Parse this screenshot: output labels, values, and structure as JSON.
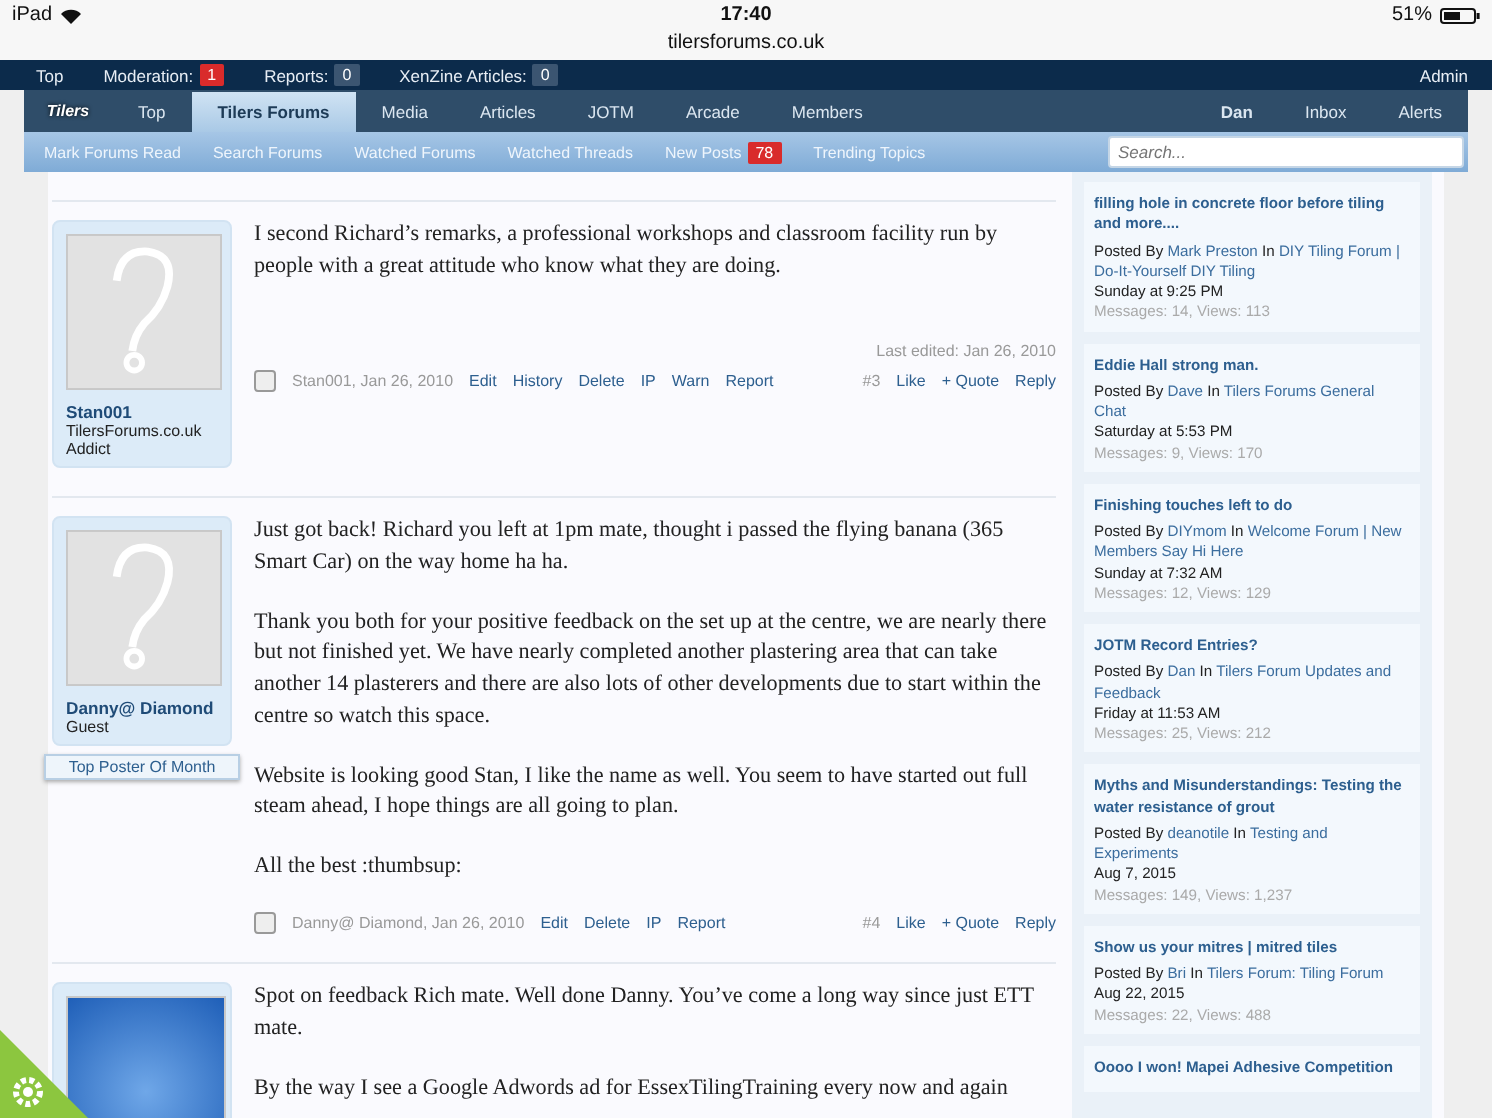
{
  "status_bar": {
    "device": "iPad",
    "time": "17:40",
    "battery": "51%",
    "url": "tilersforums.co.uk"
  },
  "admin_bar": {
    "items": [
      {
        "label": "Top"
      },
      {
        "label": "Moderation:",
        "count": "1",
        "alert": true
      },
      {
        "label": "Reports:",
        "count": "0",
        "alert": false
      },
      {
        "label": "XenZine Articles:",
        "count": "0",
        "alert": false
      }
    ],
    "right": "Admin"
  },
  "nav": {
    "logo": "Tilers",
    "tabs": [
      {
        "label": "Top",
        "selected": false
      },
      {
        "label": "Tilers Forums",
        "selected": true
      },
      {
        "label": "Media",
        "selected": false
      },
      {
        "label": "Articles",
        "selected": false
      },
      {
        "label": "JOTM",
        "selected": false
      },
      {
        "label": "Arcade",
        "selected": false
      },
      {
        "label": "Members",
        "selected": false
      }
    ],
    "user": "Dan",
    "links": [
      "Inbox",
      "Alerts"
    ]
  },
  "subnav": {
    "links": [
      {
        "label": "Mark Forums Read"
      },
      {
        "label": "Search Forums"
      },
      {
        "label": "Watched Forums"
      },
      {
        "label": "Watched Threads"
      },
      {
        "label": "New Posts",
        "count": "78"
      },
      {
        "label": "Trending Topics"
      }
    ],
    "search": {
      "placeholder": "Search..."
    }
  },
  "posts": [
    {
      "kind": "default_avatar",
      "selected": false,
      "user": "Stan001",
      "user_titles": [
        "TilersForums.co.uk",
        "Addict"
      ],
      "paragraphs": [
        "I second Richard’s remarks, a professional workshops and classroom facility run by people with a great attitude who know what they are doing."
      ],
      "last_edited": "Last edited: Jan 26, 2010",
      "byline": "Stan001, Jan 26, 2010",
      "actions": [
        "Edit",
        "History",
        "Delete",
        "IP",
        "Warn",
        "Report"
      ],
      "number": "#3",
      "reactions": [
        "Like",
        "+ Quote",
        "Reply"
      ]
    },
    {
      "kind": "default_avatar",
      "selected": false,
      "user": "Danny@ Diamond",
      "user_titles": [
        "Guest"
      ],
      "banner": "Top Poster Of Month",
      "paragraphs": [
        "Just got back! Richard you left at 1pm mate, thought i passed the flying banana (365 Smart Car) on the way home ha ha.",
        "Thank you both for your positive feedback on the set up at the centre, we are nearly there but not finished yet. We have nearly completed another plastering area that can take another 14 plasterers and there are also lots of other developments due to start within the centre so watch this space.",
        "Website is looking good Stan, I like the name as well. You seem to have started out full steam ahead, I hope things are all going to plan.",
        "All the best :thumbsup:"
      ],
      "byline": "Danny@ Diamond, Jan 26, 2010",
      "actions": [
        "Edit",
        "Delete",
        "IP",
        "Report"
      ],
      "number": "#4",
      "reactions": [
        "Like",
        "+ Quote",
        "Reply"
      ]
    },
    {
      "kind": "photo_avatar",
      "paragraphs": [
        "Spot on feedback Rich mate. Well done Danny. You’ve come a long way since just ETT mate.",
        "By the way I see a Google Adwords ad for EssexTilingTraining every now and again"
      ]
    }
  ],
  "sidebar": {
    "threads": [
      {
        "title": "filling hole in concrete floor before tiling and more....",
        "posted_by": "Posted By",
        "author": "Mark Preston",
        "in": "In",
        "forum": "DIY Tiling Forum | Do-It-Yourself DIY Tiling",
        "date": "Sunday at 9:25 PM",
        "stats": "Messages: 14, Views: 113"
      },
      {
        "title": "Eddie Hall strong man.",
        "posted_by": "Posted By",
        "author": "Dave",
        "in": "In",
        "forum": "Tilers Forums General Chat",
        "date": "Saturday at 5:53 PM",
        "stats": "Messages: 9, Views: 170"
      },
      {
        "title": "Finishing touches left to do",
        "posted_by": "Posted By",
        "author": "DIYmom",
        "in": "In",
        "forum": "Welcome Forum | New Members Say Hi Here",
        "date": "Sunday at 7:32 AM",
        "stats": "Messages: 12, Views: 129"
      },
      {
        "title": "JOTM Record Entries?",
        "posted_by": "Posted By",
        "author": "Dan",
        "in": "In",
        "forum": "Tilers Forum Updates and Feedback",
        "date": "Friday at 11:53 AM",
        "stats": "Messages: 25, Views: 212"
      },
      {
        "title": "Myths and Misunderstandings: Testing the water resistance of grout",
        "posted_by": "Posted By",
        "author": "deanotile",
        "in": "In",
        "forum": "Testing and Experiments",
        "date": "Aug 7, 2015",
        "stats": "Messages: 149, Views: 1,237"
      },
      {
        "title": "Show us your mitres | mitred tiles",
        "posted_by": "Posted By",
        "author": "Bri",
        "in": "In",
        "forum": "Tilers Forum: Tiling Forum",
        "date": "Aug 22, 2015",
        "stats": "Messages: 22, Views: 488"
      },
      {
        "title": "Oooo I won! Mapei Adhesive Competition"
      }
    ]
  }
}
